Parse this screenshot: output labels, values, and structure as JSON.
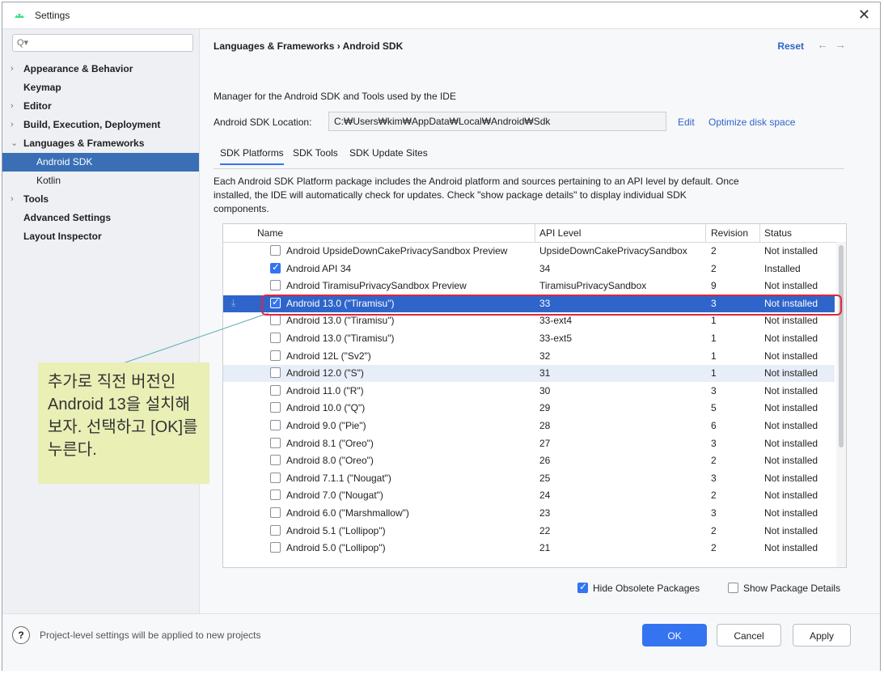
{
  "window": {
    "title": "Settings"
  },
  "search": {
    "placeholder": "Q▾"
  },
  "sidebar": {
    "items": [
      {
        "label": "Appearance & Behavior",
        "chevron": "›"
      },
      {
        "label": "Keymap",
        "chevron": ""
      },
      {
        "label": "Editor",
        "chevron": "›"
      },
      {
        "label": "Build, Execution, Deployment",
        "chevron": "›"
      },
      {
        "label": "Languages & Frameworks",
        "chevron": "⌄"
      },
      {
        "label": "Android SDK",
        "chevron": ""
      },
      {
        "label": "Kotlin",
        "chevron": ""
      },
      {
        "label": "Tools",
        "chevron": "›"
      },
      {
        "label": "Advanced Settings",
        "chevron": ""
      },
      {
        "label": "Layout Inspector",
        "chevron": ""
      }
    ]
  },
  "callout": {
    "lines": [
      "추가로 직전 버전인",
      "Android 13을 설치해",
      "보자. 선택하고 [OK]를",
      "누른다."
    ]
  },
  "header": {
    "breadcrumb": "Languages & Frameworks  ›  Android SDK",
    "reset": "Reset",
    "back": "←",
    "forward": "→"
  },
  "main": {
    "description": "Manager for the Android SDK and Tools used by the IDE",
    "location_label": "Android SDK Location:",
    "location_value": "C:₩Users₩kim₩AppData₩Local₩Android₩Sdk",
    "edit": "Edit",
    "optimize": "Optimize disk space",
    "tabs": [
      "SDK Platforms",
      "SDK Tools",
      "SDK Update Sites"
    ],
    "info": "Each Android SDK Platform package includes the Android platform and sources pertaining to an API level by default. Once installed, the IDE will automatically check for updates. Check \"show package details\" to display individual SDK components."
  },
  "table": {
    "headers": [
      "Name",
      "API Level",
      "Revision",
      "Status"
    ],
    "rows": [
      {
        "checked": false,
        "name": "Android UpsideDownCakePrivacySandbox Preview",
        "api": "UpsideDownCakePrivacySandbox",
        "rev": "2",
        "status": "Not installed"
      },
      {
        "checked": true,
        "name": "Android API 34",
        "api": "34",
        "rev": "2",
        "status": "Installed"
      },
      {
        "checked": false,
        "name": "Android TiramisuPrivacySandbox Preview",
        "api": "TiramisuPrivacySandbox",
        "rev": "9",
        "status": "Not installed"
      },
      {
        "checked": true,
        "name": "Android 13.0 (\"Tiramisu\")",
        "api": "33",
        "rev": "3",
        "status": "Not installed",
        "selected": true,
        "download": "⤓"
      },
      {
        "checked": false,
        "name": "Android 13.0 (\"Tiramisu\")",
        "api": "33-ext4",
        "rev": "1",
        "status": "Not installed"
      },
      {
        "checked": false,
        "name": "Android 13.0 (\"Tiramisu\")",
        "api": "33-ext5",
        "rev": "1",
        "status": "Not installed"
      },
      {
        "checked": false,
        "name": "Android 12L (\"Sv2\")",
        "api": "32",
        "rev": "1",
        "status": "Not installed"
      },
      {
        "checked": false,
        "name": "Android 12.0 (\"S\")",
        "api": "31",
        "rev": "1",
        "status": "Not installed",
        "hover": true
      },
      {
        "checked": false,
        "name": "Android 11.0 (\"R\")",
        "api": "30",
        "rev": "3",
        "status": "Not installed"
      },
      {
        "checked": false,
        "name": "Android 10.0 (\"Q\")",
        "api": "29",
        "rev": "5",
        "status": "Not installed"
      },
      {
        "checked": false,
        "name": "Android 9.0 (\"Pie\")",
        "api": "28",
        "rev": "6",
        "status": "Not installed"
      },
      {
        "checked": false,
        "name": "Android 8.1 (\"Oreo\")",
        "api": "27",
        "rev": "3",
        "status": "Not installed"
      },
      {
        "checked": false,
        "name": "Android 8.0 (\"Oreo\")",
        "api": "26",
        "rev": "2",
        "status": "Not installed"
      },
      {
        "checked": false,
        "name": "Android 7.1.1 (\"Nougat\")",
        "api": "25",
        "rev": "3",
        "status": "Not installed"
      },
      {
        "checked": false,
        "name": "Android 7.0 (\"Nougat\")",
        "api": "24",
        "rev": "2",
        "status": "Not installed"
      },
      {
        "checked": false,
        "name": "Android 6.0 (\"Marshmallow\")",
        "api": "23",
        "rev": "3",
        "status": "Not installed"
      },
      {
        "checked": false,
        "name": "Android 5.1 (\"Lollipop\")",
        "api": "22",
        "rev": "2",
        "status": "Not installed"
      },
      {
        "checked": false,
        "name": "Android 5.0 (\"Lollipop\")",
        "api": "21",
        "rev": "2",
        "status": "Not installed"
      }
    ]
  },
  "options": {
    "hide_obsolete": {
      "label": "Hide Obsolete Packages",
      "checked": true
    },
    "show_details": {
      "label": "Show Package Details",
      "checked": false
    }
  },
  "footer": {
    "help": "?",
    "note": "Project-level settings will be applied to new projects",
    "ok": "OK",
    "cancel": "Cancel",
    "apply": "Apply"
  },
  "colors": {
    "accent": "#3574f0",
    "selection": "#2f65ca",
    "highlight": "#e0263c",
    "callout": "#e9efb5"
  }
}
